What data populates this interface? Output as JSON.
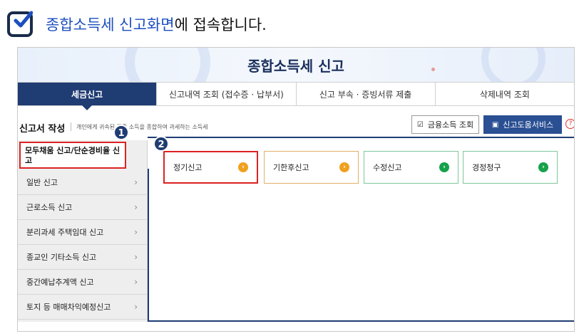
{
  "instruction": {
    "highlight": "종합소득세 신고화면",
    "rest": "에 접속합니다."
  },
  "banner": {
    "title": "종합소득세 신고"
  },
  "tabs": [
    {
      "label": "세금신고",
      "active": true
    },
    {
      "label": "신고내역 조회 (접수증 · 납부서)",
      "active": false
    },
    {
      "label": "신고 부속 · 증빙서류 제출",
      "active": false
    },
    {
      "label": "삭제내역 조회",
      "active": false
    }
  ],
  "section": {
    "title": "신고서 작성",
    "description": "개인에게 귀속된 각종 소득을 종합하여 과세하는 소득세"
  },
  "buttons": {
    "financial_income": "금융소득 조회",
    "help_service": "신고도움서비스"
  },
  "badges": {
    "one": "1",
    "two": "2"
  },
  "sidebar": {
    "active": "모두채움 신고/단순경비율 신고",
    "items": [
      {
        "label": "일반 신고"
      },
      {
        "label": "근로소득 신고"
      },
      {
        "label": "분리과세 주택임대 신고"
      },
      {
        "label": "종교인 기타소득 신고"
      },
      {
        "label": "중간예납추계액 신고"
      },
      {
        "label": "토지 등 매매차익예정신고"
      }
    ]
  },
  "cards": [
    {
      "label": "정기신고"
    },
    {
      "label": "기한후신고"
    },
    {
      "label": "수정신고"
    },
    {
      "label": "경정청구"
    }
  ],
  "colors": {
    "navy": "#1f3c73",
    "highlight_blue": "#1c4fc0",
    "red_outline": "#dd2222",
    "orange": "#f0a020",
    "green": "#17a14a"
  }
}
